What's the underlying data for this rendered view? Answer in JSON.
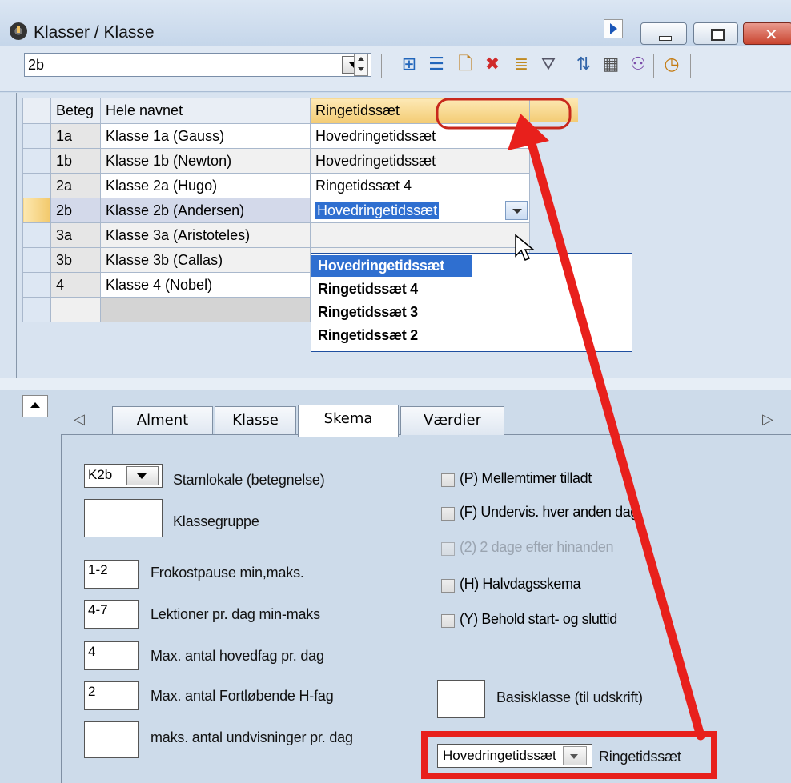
{
  "window": {
    "title": "Klasser / Klasse"
  },
  "toolbar": {
    "selected_class": "2b",
    "icons": [
      "grid-icon",
      "list-icon",
      "new-icon",
      "delete-icon",
      "edit-icon",
      "filter-icon",
      "sort-icon",
      "calc-icon",
      "group-icon",
      "clock-icon"
    ]
  },
  "grid": {
    "headers": [
      "Beteg",
      "Hele navnet",
      "Ringetidssæt"
    ],
    "rows": [
      {
        "code": "1a",
        "name": "Klasse 1a (Gauss)",
        "bell": "Hovedringetidssæt"
      },
      {
        "code": "1b",
        "name": "Klasse 1b (Newton)",
        "bell": "Hovedringetidssæt"
      },
      {
        "code": "2a",
        "name": "Klasse 2a (Hugo)",
        "bell": "Ringetidssæt 4"
      },
      {
        "code": "2b",
        "name": "Klasse 2b (Andersen)",
        "bell": "Hovedringetidssæt"
      },
      {
        "code": "3a",
        "name": "Klasse 3a (Aristoteles)",
        "bell": ""
      },
      {
        "code": "3b",
        "name": "Klasse 3b (Callas)",
        "bell": ""
      },
      {
        "code": "4",
        "name": "Klasse 4 (Nobel)",
        "bell": ""
      }
    ],
    "dropdown_options": [
      "Hovedringetidssæt",
      "Ringetidssæt 4",
      "Ringetidssæt 3",
      "Ringetidssæt 2"
    ]
  },
  "tabs": [
    "Alment",
    "Klasse",
    "Skema",
    "Værdier"
  ],
  "form": {
    "home_room_value": "K2b",
    "home_room_label": "Stamlokale (betegnelse)",
    "class_group_value": "",
    "class_group_label": "Klassegruppe",
    "lunch_value": "1-2",
    "lunch_label": "Frokostpause min,maks.",
    "lessons_value": "4-7",
    "lessons_label": "Lektioner pr. dag min-maks",
    "main_subj_value": "4",
    "main_subj_label": "Max. antal hovedfag pr. dag",
    "consec_value": "2",
    "consec_label": "Max. antal Fortløbende H-fag",
    "undv_value": "",
    "undv_label": "maks. antal undvisninger pr. dag",
    "chk_p": "(P) Mellemtimer tilladt",
    "chk_f": "(F) Undervis. hver anden dag",
    "chk_2": "(2) 2 dage efter hinanden",
    "chk_h": "(H) Halvdagsskema",
    "chk_y": "(Y) Behold start- og sluttid",
    "basis_value": "",
    "basis_label": "Basisklasse (til udskrift)",
    "bell_value": "Hovedringetidssæt",
    "bell_label": "Ringetidssæt"
  },
  "annotation_color": "#e8201c"
}
